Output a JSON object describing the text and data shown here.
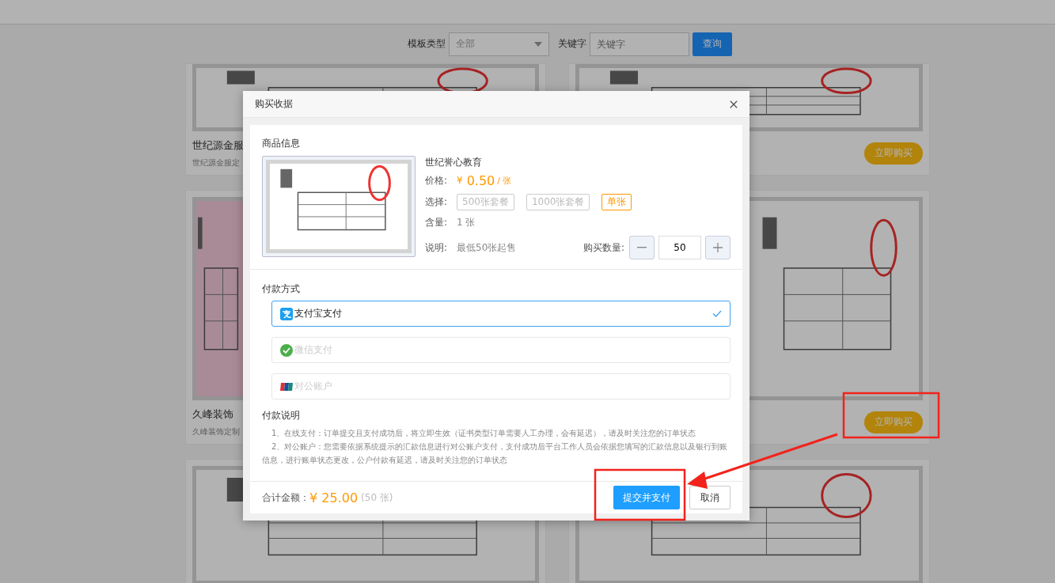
{
  "filter_bar": {
    "type_label": "模板类型",
    "type_value": "全部",
    "keyword_label": "关键字",
    "keyword_placeholder": "关键字",
    "search_button": "查询"
  },
  "templates": [
    {
      "kind": "template",
      "title": "世纪源金服",
      "description": "世纪源金服定"
    },
    {
      "kind": "template",
      "buy_button": "立即购买"
    },
    {
      "kind": "template",
      "title": "久峰装饰",
      "description": "久峰装饰定制"
    },
    {
      "kind": "template",
      "buy_button": "立即购买"
    },
    {
      "kind": "picture"
    },
    {
      "kind": "picture"
    }
  ],
  "dialog": {
    "title": "购买收据",
    "product": {
      "section_title": "商品信息",
      "name": "世纪誉心教育",
      "price_label": "价格:",
      "currency": "¥",
      "price": "0.50",
      "unit": "/ 张",
      "choice_label": "选择:",
      "choices": [
        {
          "label": "500张套餐",
          "selected": false
        },
        {
          "label": "1000张套餐",
          "selected": false
        },
        {
          "label": "单张",
          "selected": true
        }
      ],
      "content_label": "含量:",
      "content": "1 张",
      "note_label": "说明:",
      "note": "最低50张起售",
      "amount_label": "购买数量:",
      "amount": "50"
    },
    "payment": {
      "section_title": "付款方式",
      "methods": [
        {
          "kind": "alipay",
          "label": "支付宝支付",
          "selected": true
        },
        {
          "kind": "wechat",
          "label": "微信支付",
          "selected": false
        },
        {
          "kind": "unionpay",
          "label": "对公账户",
          "selected": false
        }
      ]
    },
    "notes": {
      "section_title": "付款说明",
      "items": [
        "1、在线支付：订单提交且支付成功后，将立即生效（证书类型订单需要人工办理，会有延迟），请及时关注您的订单状态",
        "2、对公账户：您需要依据系统提示的汇款信息进行对公账户支付，支付成功后平台工作人员会依据您填写的汇款信息以及银行到账信息，进行账单状态更改，公户付款有延迟，请及时关注您的订单状态"
      ]
    },
    "footer": {
      "total_label": "合计金额：",
      "total": "¥ 25.00",
      "total_count": "(50 张)",
      "submit_button": "提交并支付",
      "cancel_button": "取消"
    }
  }
}
